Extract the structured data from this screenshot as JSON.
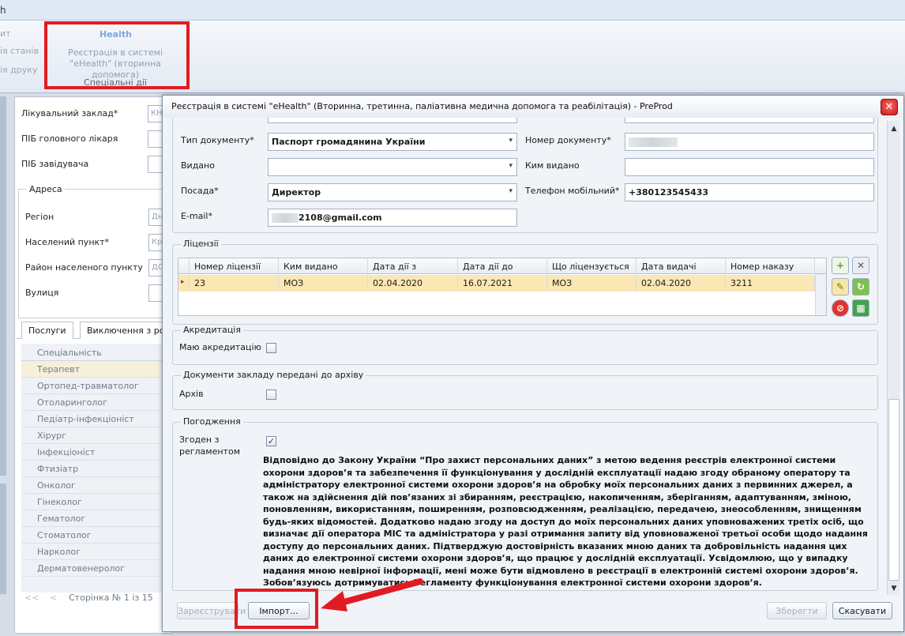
{
  "app": {
    "title_fragment": "h",
    "ribbon_left_items": [
      "ит",
      "ія станів",
      "ія друку"
    ],
    "ribbon_button": {
      "icon_text": "Health",
      "label": "Реєстрація в системі \"eHealth\" (вторинна допомога)"
    },
    "ribbon_group": "Спеціальні дії"
  },
  "background_form": {
    "fields": [
      {
        "label": "Лікувальний заклад*",
        "value": "КН"
      },
      {
        "label": "ПІБ головного лікаря",
        "value": ""
      },
      {
        "label": "ПІБ завідувача",
        "value": ""
      }
    ],
    "address": {
      "title": "Адреса",
      "fields": [
        {
          "label": "Регіон",
          "value": "Дн"
        },
        {
          "label": "Населений пункт*",
          "value": "Кр"
        },
        {
          "label": "Район населеного пункту",
          "value": "ДС"
        },
        {
          "label": "Вулиця",
          "value": ""
        }
      ]
    },
    "tabs": [
      "Послуги",
      "Виключення з ро"
    ],
    "list_header": "Спеціальність",
    "list_items": [
      "Терапевт",
      "Ортопед-травматолог",
      "Отоларинголог",
      "Педіатр-інфекціоніст",
      "Хірург",
      "Інфекціоніст",
      "Фтизіатр",
      "Онколог",
      "Гінеколог",
      "Гематолог",
      "Стоматолог",
      "Нарколог",
      "Дерматовенеролог"
    ],
    "pager": "Сторінка № 1 із 15",
    "pager_first": "<<",
    "pager_prev": "<"
  },
  "dialog": {
    "title": "Реєстрація в системі \"eHealth\" (Вторинна, третинна, паліативна медична допомога та реабілітація) - PreProd",
    "close_glyph": "✕",
    "doc_type_label": "Тип документу*",
    "doc_type_value": "Паспорт громадянина України",
    "doc_number_label": "Номер документу*",
    "doc_number_value": "",
    "issued_label": "Видано",
    "issued_value": "",
    "issued_by_label": "Ким видано",
    "issued_by_value": "",
    "position_label": "Посада*",
    "position_value": "Директор",
    "phone_label": "Телефон мобільний*",
    "phone_value": "+380123545433",
    "email_label": "E-mail*",
    "email_value": "2108@gmail.com",
    "licenses": {
      "title": "Ліцензії",
      "columns": [
        "Номер ліцензії",
        "Ким видано",
        "Дата дії з",
        "Дата дії до",
        "Що ліцензується",
        "Дата видачі",
        "Номер наказу"
      ],
      "rows": [
        [
          "23",
          "МОЗ",
          "02.04.2020",
          "16.07.2021",
          "МОЗ",
          "02.04.2020",
          "3211"
        ]
      ],
      "row_marker": "▸"
    },
    "accreditation": {
      "title": "Акредитація",
      "label": "Маю акредитацію",
      "checked": false
    },
    "archive": {
      "title": "Документи закладу передані до архіву",
      "label": "Архів",
      "checked": false
    },
    "consent": {
      "title": "Погодження",
      "label": "Згоден з регламентом",
      "checked": true,
      "check_glyph": "✓",
      "text": "Відповідно до Закону України “Про захист персональних даних” з метою ведення реєстрів електронної системи охорони здоров’я та забезпечення її функціонування у дослідній експлуатації надаю згоду обраному оператору та адміністратору електронної системи охорони здоров’я на обробку моїх персональних даних з первинних джерел, а також на здійснення дій пов’язаних зі збиранням, реєстрацією, накопиченням, зберіганням, адаптуванням, зміною, поновленням, використанням, поширенням, розповсюдженням, реалізацією, передачею, знеособленням, знищенням будь-яких відомостей. Додатково надаю згоду на доступ до моїх персональних даних уповноважених третіх осіб, що визначає дії оператора МІС та адміністратора у разі отримання запиту від уповноваженої третьої особи щодо надання доступу до персональних даних. Підтверджую достовірність вказаних мною даних та добровільність надання цих даних до електронної системи охорони здоров’я, що працює у дослідній експлуатації. Усвідомлюю, що у випадку надання мною невірної інформації, мені може бути відмовлено в реєстрації в електронній системі охорони здоров’я. Зобов’язуюсь дотримуватись Регламенту функціонування електронної системи охорони здоров’я."
    },
    "buttons": {
      "register": "Зареєструвати",
      "import": "Імпорт...",
      "save": "Зберегти",
      "cancel": "Скасувати"
    }
  },
  "colors": {
    "highlight": "#e11b22",
    "selected_row": "#fbe7b4"
  }
}
